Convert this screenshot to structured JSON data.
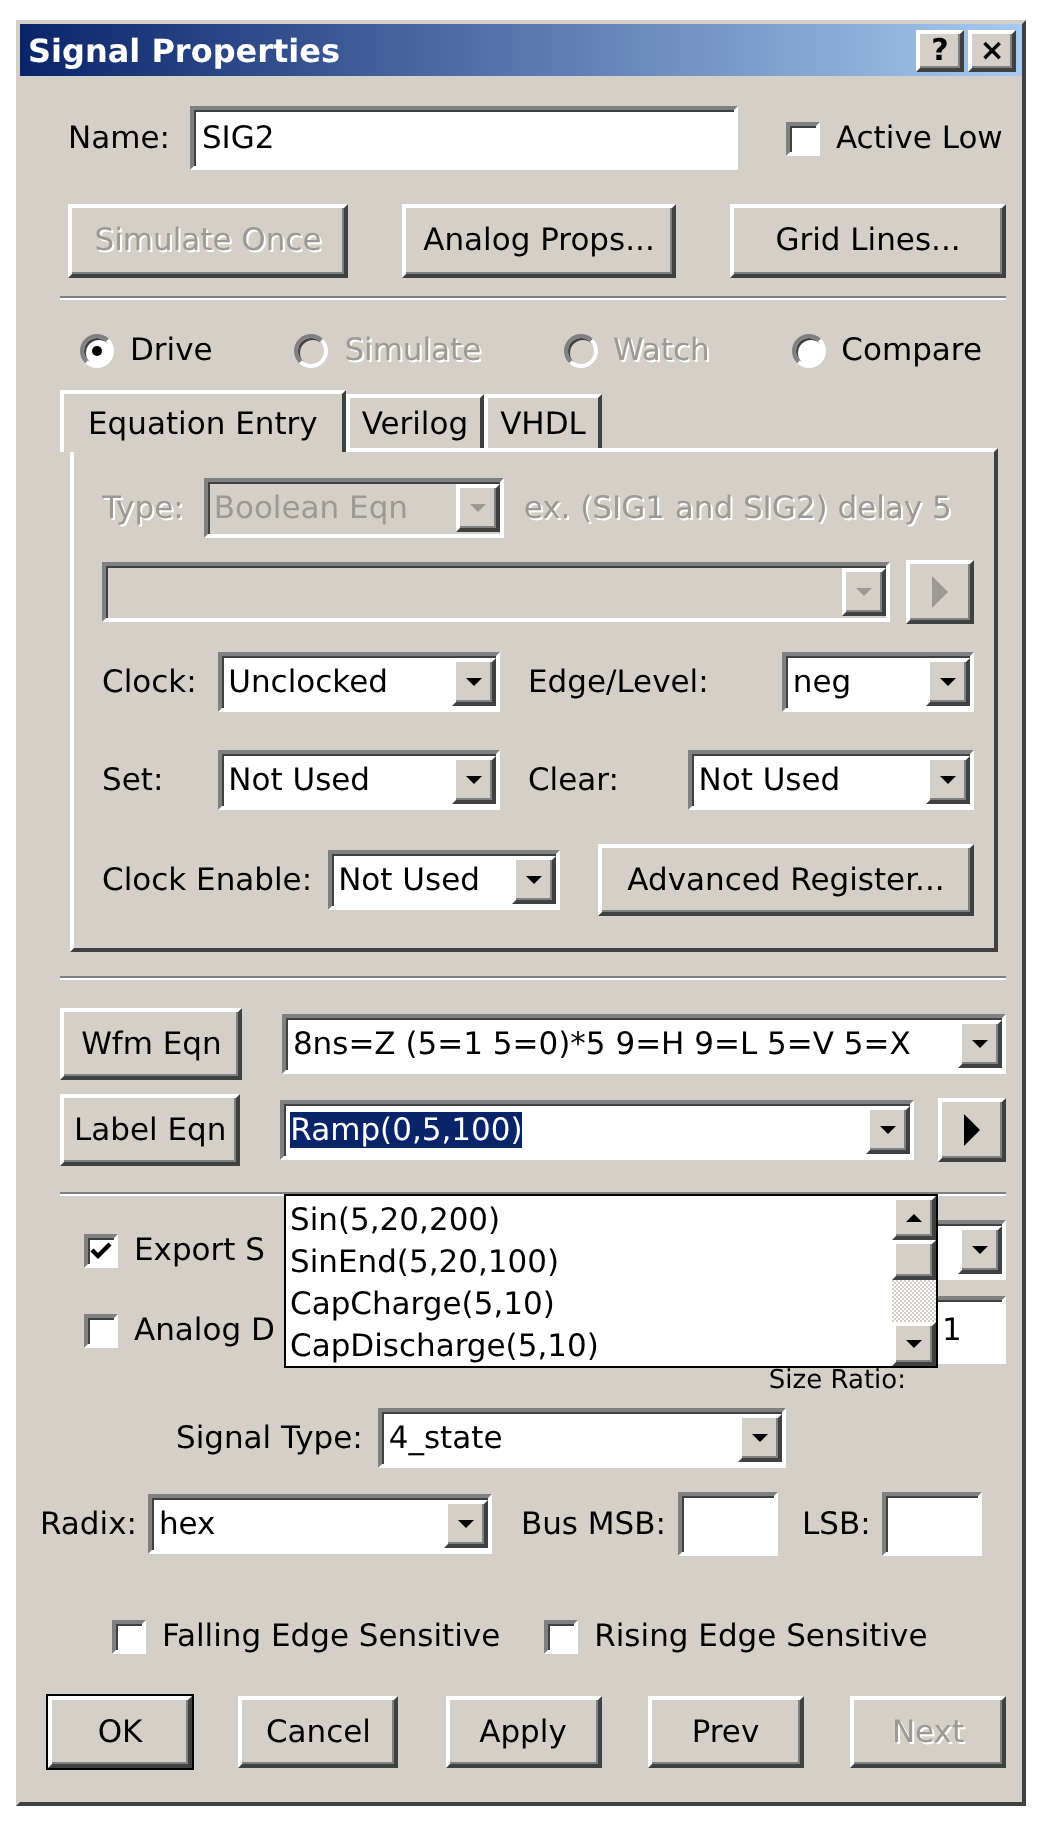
{
  "window": {
    "title": "Signal Properties",
    "help_button": "?",
    "close_button": "×"
  },
  "name": {
    "label": "Name:",
    "value": "SIG2"
  },
  "active_low": {
    "label": "Active Low",
    "checked": false
  },
  "top_buttons": [
    {
      "label": "Simulate Once",
      "disabled": true
    },
    {
      "label": "Analog Props...",
      "disabled": false
    },
    {
      "label": "Grid Lines...",
      "disabled": false
    }
  ],
  "modes": [
    {
      "label": "Drive",
      "selected": true,
      "disabled": false
    },
    {
      "label": "Simulate",
      "selected": false,
      "disabled": true
    },
    {
      "label": "Watch",
      "selected": false,
      "disabled": true
    },
    {
      "label": "Compare",
      "selected": false,
      "disabled": false
    }
  ],
  "tabs": [
    {
      "label": "Equation Entry",
      "selected": true
    },
    {
      "label": "Verilog",
      "selected": false
    },
    {
      "label": "VHDL",
      "selected": false
    }
  ],
  "equation": {
    "type": {
      "label": "Type:",
      "value": "Boolean Eqn",
      "disabled": true
    },
    "hint": "ex. (SIG1 and SIG2) delay 5",
    "expression_disabled": true,
    "clock": {
      "label": "Clock:",
      "value": "Unclocked"
    },
    "edge": {
      "label": "Edge/Level:",
      "value": "neg"
    },
    "set": {
      "label": "Set:",
      "value": "Not Used"
    },
    "clear": {
      "label": "Clear:",
      "value": "Not Used"
    },
    "clock_enable": {
      "label": "Clock Enable:",
      "value": "Not Used"
    },
    "advanced_button": "Advanced Register..."
  },
  "wfm_eqn": {
    "button": "Wfm Eqn",
    "value": "8ns=Z (5=1 5=0)*5 9=H 9=L 5=V 5=X"
  },
  "label_eqn": {
    "button": "Label Eqn",
    "value": "Ramp(0,5,100)",
    "expanded": true,
    "options": [
      "Sin(5,20,200)",
      "SinEnd(5,20,100)",
      "CapCharge(5,10)",
      "CapDischarge(5,10)"
    ]
  },
  "export": {
    "label": "Export S",
    "checked": true
  },
  "analog": {
    "label": "Analog D",
    "checked": false
  },
  "size_ratio": {
    "label": "Size Ratio:",
    "value": "1"
  },
  "signal_type": {
    "label": "Signal Type:",
    "value": "4_state"
  },
  "radix": {
    "label": "Radix:",
    "value": "hex"
  },
  "bus_msb": {
    "label": "Bus MSB:"
  },
  "lsb": {
    "label": "LSB:"
  },
  "edge_checks": [
    {
      "label": "Falling Edge Sensitive",
      "checked": false
    },
    {
      "label": "Rising Edge Sensitive",
      "checked": false
    }
  ],
  "bottom_buttons": [
    {
      "label": "OK",
      "default": true,
      "disabled": false
    },
    {
      "label": "Cancel",
      "default": false,
      "disabled": false
    },
    {
      "label": "Apply",
      "default": false,
      "disabled": false
    },
    {
      "label": "Prev",
      "default": false,
      "disabled": false
    },
    {
      "label": "Next",
      "default": false,
      "disabled": true
    }
  ]
}
